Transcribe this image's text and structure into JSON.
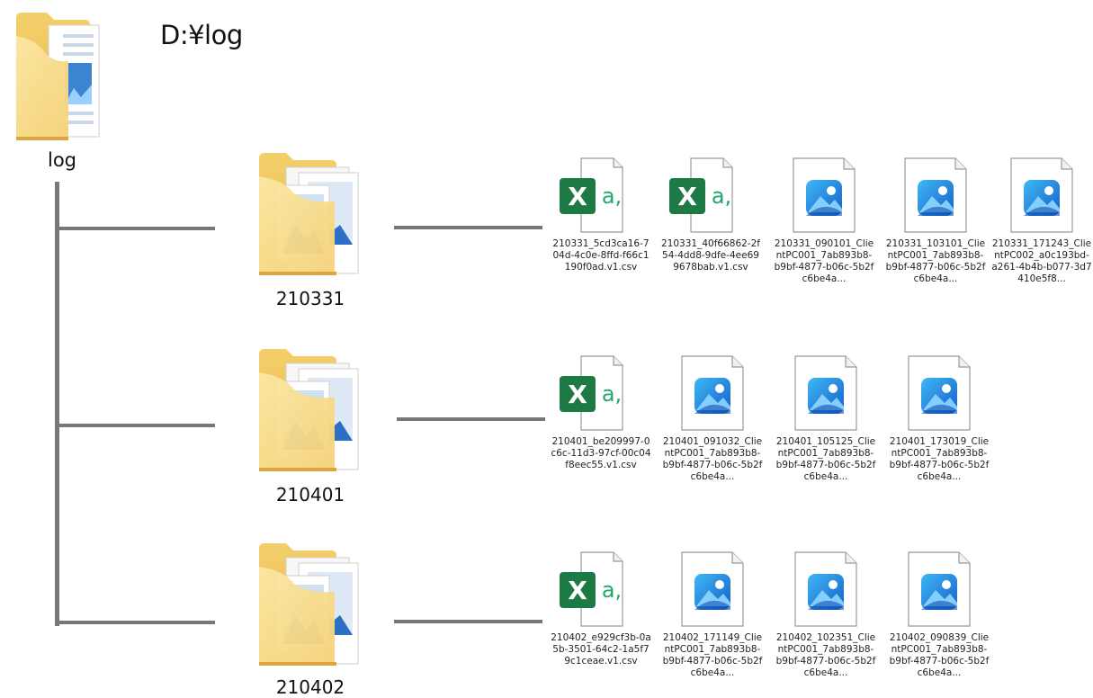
{
  "page": {
    "path_title": "D:¥log",
    "root_folder_label": "log",
    "root_folder_icon": "folder-with-images-icon"
  },
  "groups": [
    {
      "folder": "210331",
      "files": [
        {
          "type": "csv",
          "icon": "excel-csv-file-icon",
          "name": "210331_5cd3ca16-704d-4c0e-8ffd-f66c1190f0ad.v1.csv"
        },
        {
          "type": "csv",
          "icon": "excel-csv-file-icon",
          "name": "210331_40f66862-2f54-4dd8-9dfe-4ee699678bab.v1.csv"
        },
        {
          "type": "image",
          "icon": "photo-file-icon",
          "name": "210331_090101_ClientPC001_7ab893b8-b9bf-4877-b06c-5b2fc6be4a..."
        },
        {
          "type": "image",
          "icon": "photo-file-icon",
          "name": "210331_103101_ClientPC001_7ab893b8-b9bf-4877-b06c-5b2fc6be4a..."
        },
        {
          "type": "image",
          "icon": "photo-file-icon",
          "name": "210331_171243_ClientPC002_a0c193bd-a261-4b4b-b077-3d7410e5f8..."
        }
      ]
    },
    {
      "folder": "210401",
      "files": [
        {
          "type": "csv",
          "icon": "excel-csv-file-icon",
          "name": "210401_be209997-0c6c-11d3-97cf-00c04f8eec55.v1.csv"
        },
        {
          "type": "image",
          "icon": "photo-file-icon",
          "name": "210401_091032_ClientPC001_7ab893b8-b9bf-4877-b06c-5b2fc6be4a..."
        },
        {
          "type": "image",
          "icon": "photo-file-icon",
          "name": "210401_105125_ClientPC001_7ab893b8-b9bf-4877-b06c-5b2fc6be4a..."
        },
        {
          "type": "image",
          "icon": "photo-file-icon",
          "name": "210401_173019_ClientPC001_7ab893b8-b9bf-4877-b06c-5b2fc6be4a..."
        }
      ]
    },
    {
      "folder": "210402",
      "files": [
        {
          "type": "csv",
          "icon": "excel-csv-file-icon",
          "name": "210402_e929cf3b-0a5b-3501-64c2-1a5f79c1ceae.v1.csv"
        },
        {
          "type": "image",
          "icon": "photo-file-icon",
          "name": "210402_171149_ClientPC001_7ab893b8-b9bf-4877-b06c-5b2fc6be4a..."
        },
        {
          "type": "image",
          "icon": "photo-file-icon",
          "name": "210402_102351_ClientPC001_7ab893b8-b9bf-4877-b06c-5b2fc6be4a..."
        },
        {
          "type": "image",
          "icon": "photo-file-icon",
          "name": "210402_090839_ClientPC001_7ab893b8-b9bf-4877-b06c-5b2fc6be4a..."
        }
      ]
    }
  ]
}
